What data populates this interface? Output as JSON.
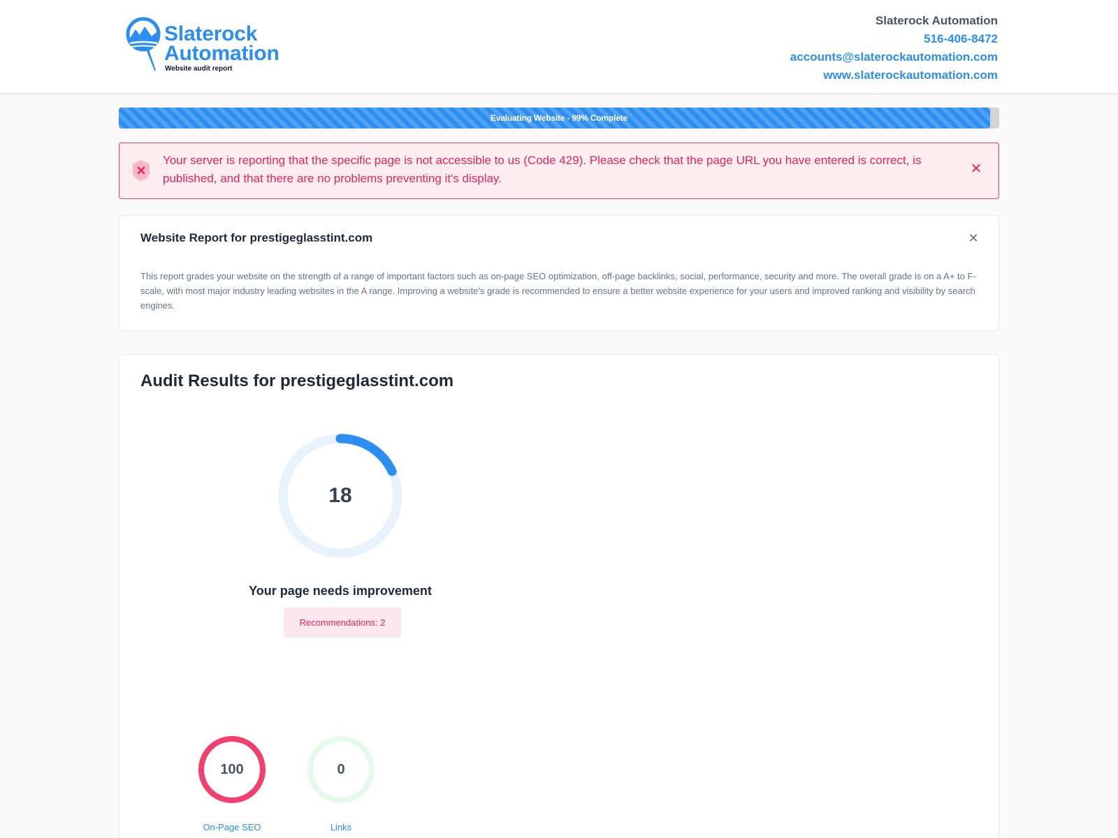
{
  "header": {
    "logo": {
      "line1": "Slaterock",
      "line2": "Automation",
      "subtitle": "Website audit report",
      "icon": "magnifier-mountain-logo-icon"
    },
    "contact": {
      "company": "Slaterock Automation",
      "phone": "516-406-8472",
      "email": "accounts@slaterockautomation.com",
      "website": "www.slaterockautomation.com"
    }
  },
  "progress": {
    "label": "Evaluating Website - 99% Complete",
    "percent": 99
  },
  "alert": {
    "icon": "shield-x-icon",
    "message": "Your server is reporting that the specific page is not accessible to us (Code 429). Please check that the page URL you have entered is correct, is published, and that there are no problems preventing it's display.",
    "close_icon": "close-icon"
  },
  "report": {
    "title": "Website Report for prestigeglasstint.com",
    "description": "This report grades your website on the strength of a range of important factors such as on-page SEO optimization, off-page backlinks, social, performance, security and more. The overall grade is on a A+ to F- scale, with most major industry leading websites in the A range. Improving a website's grade is recommended to ensure a better website experience for your users and improved ranking and visibility by search engines.",
    "close_icon": "close-icon"
  },
  "audit": {
    "title": "Audit Results for prestigeglasstint.com",
    "score": 18,
    "score_label": "Your page needs improvement",
    "recommendations": "Recommendations: 2",
    "categories": [
      {
        "label": "On-Page SEO",
        "value": "100",
        "fraction": 1.0
      },
      {
        "label": "Links",
        "value": "0",
        "fraction": 0.0
      }
    ]
  },
  "colors": {
    "brand_blue": "#2b8ef0",
    "alert_red": "#e5275c",
    "ring_track": "#e8f2fd",
    "seo_ring": "#f23f6d",
    "links_ring": "#e6faea"
  }
}
